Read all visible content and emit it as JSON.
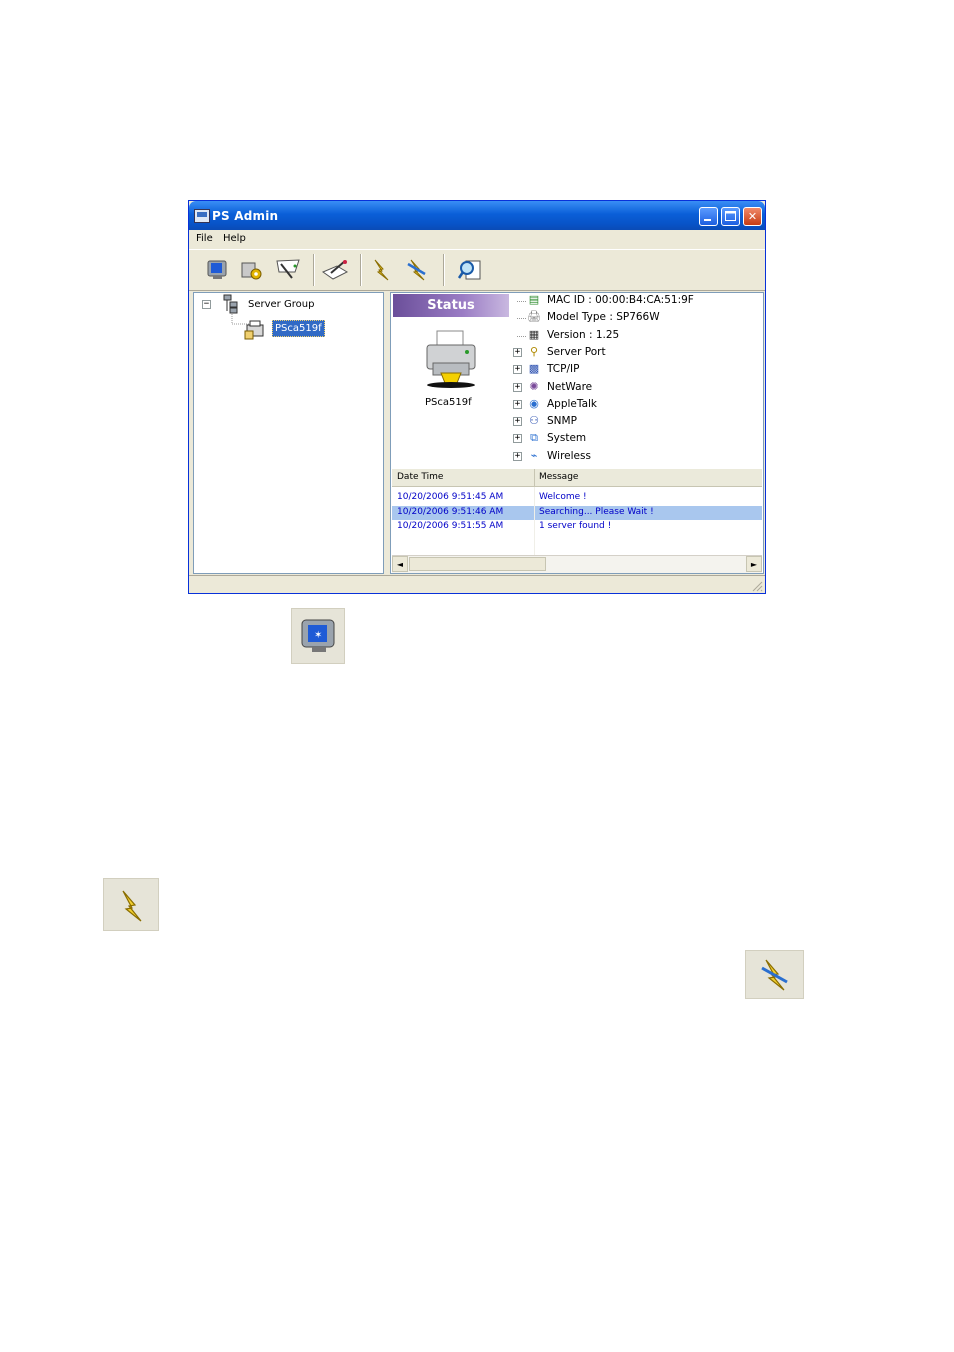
{
  "window": {
    "title": "PS Admin"
  },
  "menu": {
    "file": "File",
    "help": "Help"
  },
  "toolbar": {
    "icons": [
      "monitor-icon",
      "gear-settings-icon",
      "search-wand-icon",
      "wizard-icon",
      "lightning-icon",
      "lightning-cancel-icon",
      "magnifier-icon"
    ]
  },
  "tree": {
    "root": "Server Group",
    "expander": "−",
    "server": "PSca519f"
  },
  "status": {
    "banner": "Status",
    "printer_name": "PSca519f",
    "properties": [
      {
        "label": "MAC ID : 00:00:B4:CA:51:9F",
        "icon": "nic-icon",
        "expandable": false
      },
      {
        "label": "Model Type : SP766W",
        "icon": "printer-small-icon",
        "expandable": false
      },
      {
        "label": "Version : 1.25",
        "icon": "version-icon",
        "expandable": false
      },
      {
        "label": "Server Port",
        "icon": "port-icon",
        "expandable": true
      },
      {
        "label": "TCP/IP",
        "icon": "grid-icon",
        "expandable": true
      },
      {
        "label": "NetWare",
        "icon": "netware-icon",
        "expandable": true
      },
      {
        "label": "AppleTalk",
        "icon": "apple-icon",
        "expandable": true
      },
      {
        "label": "SNMP",
        "icon": "snmp-icon",
        "expandable": true
      },
      {
        "label": "System",
        "icon": "system-icon",
        "expandable": true
      },
      {
        "label": "Wireless",
        "icon": "wireless-icon",
        "expandable": true
      }
    ],
    "expander": "+"
  },
  "log": {
    "headers": {
      "datetime": "Date Time",
      "message": "Message"
    },
    "rows": [
      {
        "datetime": "10/20/2006 9:51:45 AM",
        "message": "Welcome !",
        "selected": false
      },
      {
        "datetime": "10/20/2006 9:51:46 AM",
        "message": "Searching... Please Wait !",
        "selected": true
      },
      {
        "datetime": "10/20/2006 9:51:55 AM",
        "message": "1 server found !",
        "selected": false
      }
    ]
  },
  "scroll": {
    "left_arrow": "◄",
    "right_arrow": "►"
  },
  "window_buttons": {
    "close": "✕"
  },
  "colors": {
    "titlebar": "#0a5fd8",
    "selection": "#316ac5",
    "log_text": "#0000c8",
    "status_banner": "#7a5ca8"
  }
}
